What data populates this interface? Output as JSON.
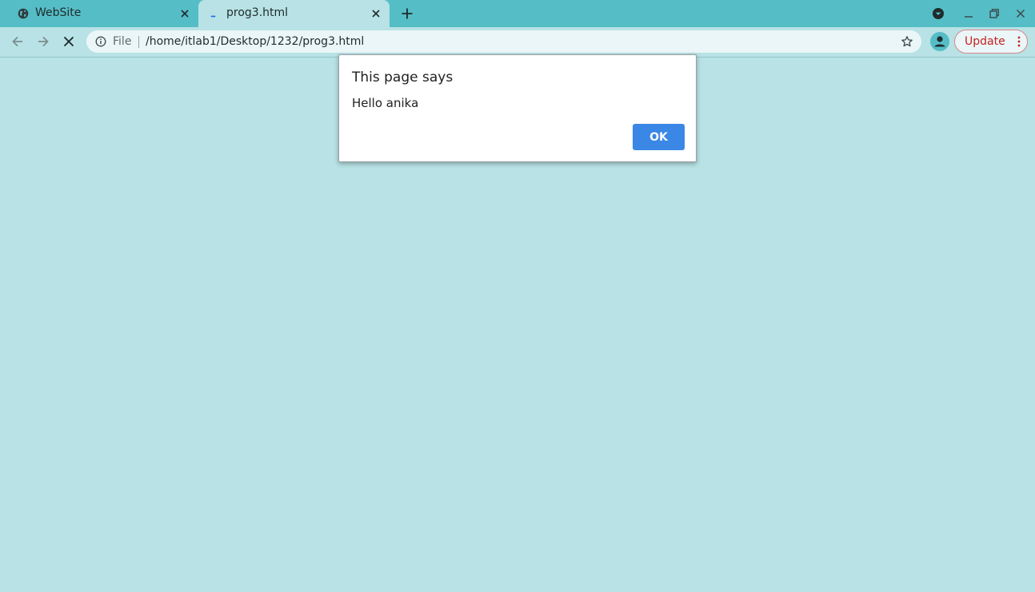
{
  "colors": {
    "tabstrip": "#55bdc6",
    "page_background": "#b8e2e5",
    "omnibox": "#eaf6f7",
    "update_accent": "#c5221f",
    "ok_button": "#3a87e6"
  },
  "browser": {
    "tabs": [
      {
        "title": "WebSite",
        "icon": "globe-icon",
        "active": false
      },
      {
        "title": "prog3.html",
        "icon": "loading-spinner-icon",
        "active": true
      }
    ],
    "omnibox": {
      "scheme_label": "File",
      "url": "/home/itlab1/Desktop/1232/prog3.html"
    },
    "update_label": "Update"
  },
  "dialog": {
    "title": "This page says",
    "message": "Hello anika",
    "ok_label": "OK"
  }
}
